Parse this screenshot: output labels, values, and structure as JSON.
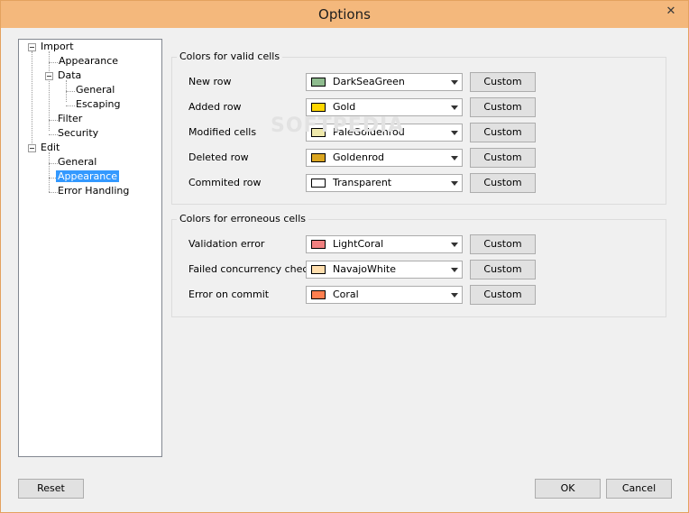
{
  "window": {
    "title": "Options",
    "close_glyph": "✕"
  },
  "tree": {
    "items": [
      {
        "label": "Import"
      },
      {
        "label": "Appearance"
      },
      {
        "label": "Data"
      },
      {
        "label": "General"
      },
      {
        "label": "Escaping"
      },
      {
        "label": "Filter"
      },
      {
        "label": "Security"
      },
      {
        "label": "Edit"
      },
      {
        "label": "General"
      },
      {
        "label": "Appearance",
        "selected": true
      },
      {
        "label": "Error Handling"
      }
    ]
  },
  "valid_group": {
    "title": "Colors for valid cells",
    "rows": [
      {
        "label": "New row",
        "value": "DarkSeaGreen",
        "color": "#8fbc8f",
        "button": "Custom"
      },
      {
        "label": "Added row",
        "value": "Gold",
        "color": "#ffd700",
        "button": "Custom"
      },
      {
        "label": "Modified cells",
        "value": "PaleGoldenrod",
        "color": "#eee8aa",
        "button": "Custom"
      },
      {
        "label": "Deleted row",
        "value": "Goldenrod",
        "color": "#daa520",
        "button": "Custom"
      },
      {
        "label": "Commited row",
        "value": "Transparent",
        "color": "#ffffff",
        "button": "Custom"
      }
    ]
  },
  "error_group": {
    "title": "Colors for erroneous cells",
    "rows": [
      {
        "label": "Validation error",
        "value": "LightCoral",
        "color": "#f08080",
        "button": "Custom"
      },
      {
        "label": "Failed concurrency check",
        "value": "NavajoWhite",
        "color": "#ffdead",
        "button": "Custom"
      },
      {
        "label": "Error on commit",
        "value": "Coral",
        "color": "#ff7f50",
        "button": "Custom"
      }
    ]
  },
  "footer": {
    "reset": "Reset",
    "ok": "OK",
    "cancel": "Cancel"
  },
  "watermark": "SOFTPEDIA"
}
